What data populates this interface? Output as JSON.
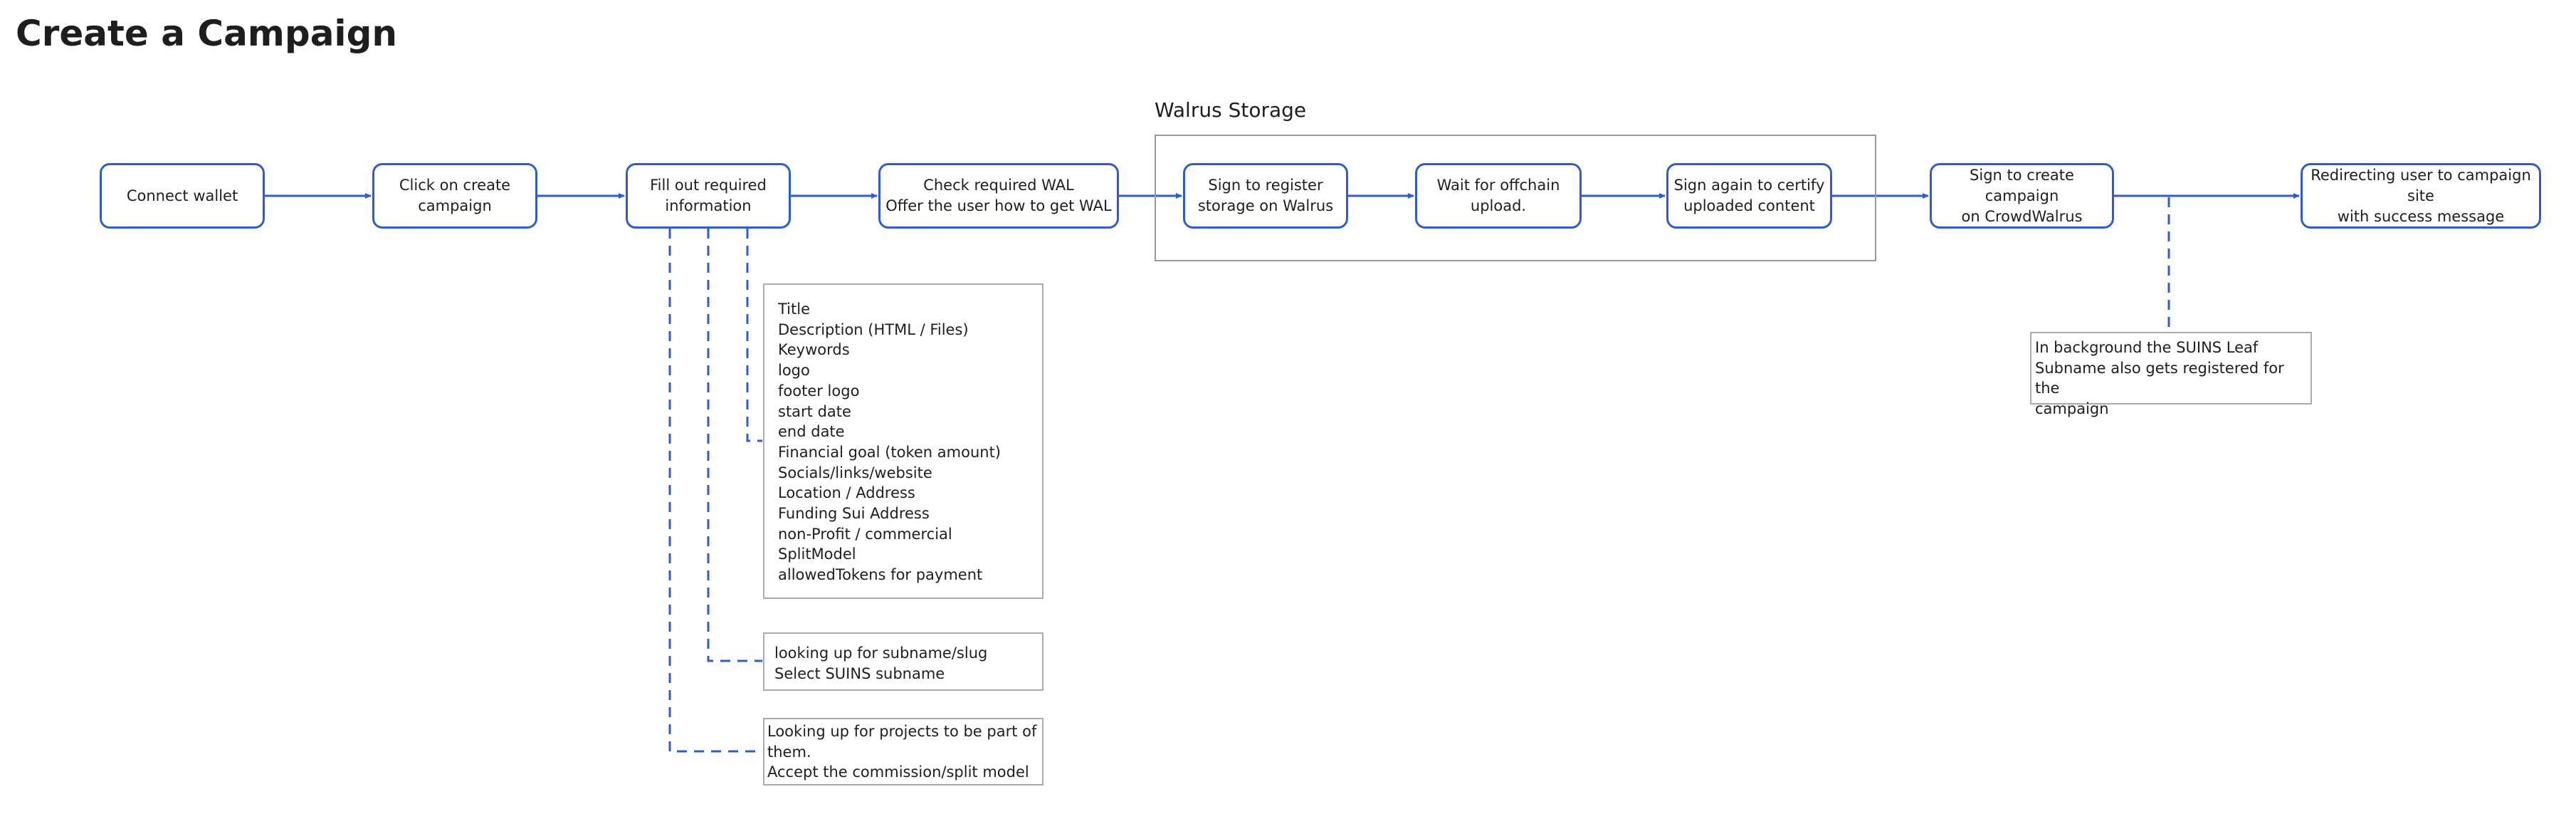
{
  "page": {
    "title": "Create a Campaign"
  },
  "walrus_group": {
    "label": "Walrus Storage"
  },
  "steps": [
    {
      "id": "connect-wallet",
      "label": "Connect wallet"
    },
    {
      "id": "click-create",
      "label": "Click on create\ncampaign"
    },
    {
      "id": "fill-info",
      "label": "Fill out required\ninformation"
    },
    {
      "id": "check-wal",
      "label": "Check required WAL\nOffer the user how to get WAL"
    },
    {
      "id": "sign-register",
      "label": "Sign to register\nstorage on Walrus"
    },
    {
      "id": "wait-upload",
      "label": "Wait for offchain\nupload."
    },
    {
      "id": "sign-certify",
      "label": "Sign again to certify\nuploaded content"
    },
    {
      "id": "sign-create",
      "label": "Sign to create campaign\non CrowdWalrus"
    },
    {
      "id": "redirect",
      "label": "Redirecting user to campaign site\nwith success message"
    }
  ],
  "notes": {
    "fields": "Title\nDescription (HTML / Files)\nKeywords\nlogo\nfooter logo\nstart date\nend date\nFinancial goal  (token amount)\nSocials/links/website\nLocation / Address\nFunding Sui Address\nnon-Profit / commercial\nSplitModel\nallowedTokens for payment",
    "subname": "looking up for subname/slug\nSelect SUINS subname",
    "projects": "Looking up for projects to be part of\nthem.\nAccept the commission/split model",
    "suins": " In background the SUINS Leaf\nSubname also gets registered for the\ncampaign"
  },
  "colors": {
    "accent": "#2f5ccc",
    "frame": "#9a9a9a",
    "note_border": "#aaaaaa",
    "text": "#1e1e1e"
  }
}
